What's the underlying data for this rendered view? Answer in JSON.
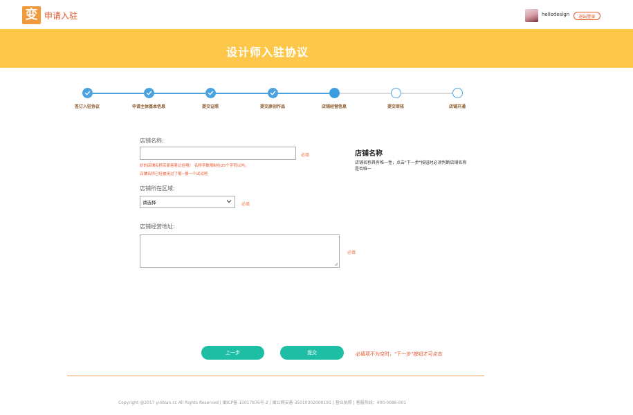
{
  "header": {
    "logo_char": "变",
    "brand": "申请入驻",
    "username": "hellodesign",
    "logout": "退出登录"
  },
  "banner": {
    "title": "设计师入驻协议"
  },
  "steps": [
    {
      "label": "签订入驻协议",
      "state": "done"
    },
    {
      "label": "申请主体基本信息",
      "state": "done"
    },
    {
      "label": "提交证照",
      "state": "done"
    },
    {
      "label": "提交原创作品",
      "state": "done"
    },
    {
      "label": "店铺经营信息",
      "state": "current"
    },
    {
      "label": "提交审核",
      "state": "todo"
    },
    {
      "label": "店铺开通",
      "state": "todo"
    }
  ],
  "form": {
    "shop_name": {
      "label": "店铺名称:",
      "value": "",
      "required": "必填",
      "hint1": "好的店铺名称买家容易记住哦！ 名称字数限制在25个字符以内。",
      "hint2": "店铺名称已经被用过了哦~换一个试试吧"
    },
    "region": {
      "label": "店铺所在区域:",
      "selected": "请选择",
      "required": "必填"
    },
    "address": {
      "label": "店铺经营地址:",
      "value": "",
      "required": "必填"
    }
  },
  "info": {
    "title": "店铺名称",
    "text": "店铺名称具有唯一性，点击\"下一步\"按钮时必须判断店铺名称是否唯一"
  },
  "actions": {
    "prev": "上一步",
    "submit": "提交",
    "note": "必填项不为空时，\"下一步\"按钮才可点击"
  },
  "footer": {
    "text": "Copyright @2017 yinbian.cc All Rights Reserved  |  闽ICP备 15017876号-2  |  闽公网安备 35010302000191  |  营业执照  |  客服热线：400-0086-001"
  },
  "colors": {
    "banner": "#fdc749",
    "accent_orange": "#e6552c",
    "step_blue": "#4aa2e0",
    "button_teal": "#1ebea5"
  }
}
